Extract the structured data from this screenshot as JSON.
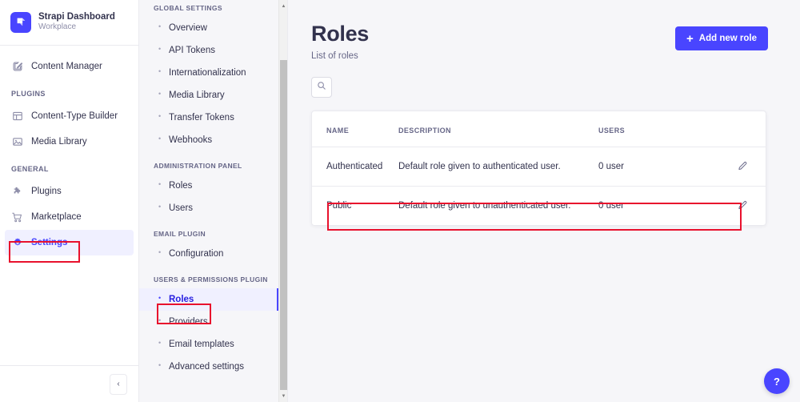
{
  "brand": {
    "title": "Strapi Dashboard",
    "subtitle": "Workplace",
    "logo_color": "#4945ff",
    "logo_icon": "strapi-logo-icon"
  },
  "sidebar": {
    "primary_items": [
      {
        "label": "Content Manager",
        "icon": "pencil-square-icon",
        "active": false
      }
    ],
    "sections": [
      {
        "label": "PLUGINS",
        "items": [
          {
            "label": "Content-Type Builder",
            "icon": "layout-icon",
            "active": false
          },
          {
            "label": "Media Library",
            "icon": "image-icon",
            "active": false
          }
        ]
      },
      {
        "label": "GENERAL",
        "items": [
          {
            "label": "Plugins",
            "icon": "puzzle-icon",
            "active": false
          },
          {
            "label": "Marketplace",
            "icon": "shopping-cart-icon",
            "active": false
          },
          {
            "label": "Settings",
            "icon": "gear-icon",
            "active": true
          }
        ]
      }
    ],
    "collapse_label": "‹"
  },
  "subnav": {
    "sections": [
      {
        "label": "GLOBAL SETTINGS",
        "items": [
          {
            "label": "Overview",
            "active": false
          },
          {
            "label": "API Tokens",
            "active": false
          },
          {
            "label": "Internationalization",
            "active": false
          },
          {
            "label": "Media Library",
            "active": false
          },
          {
            "label": "Transfer Tokens",
            "active": false
          },
          {
            "label": "Webhooks",
            "active": false
          }
        ]
      },
      {
        "label": "ADMINISTRATION PANEL",
        "items": [
          {
            "label": "Roles",
            "active": false
          },
          {
            "label": "Users",
            "active": false
          }
        ]
      },
      {
        "label": "EMAIL PLUGIN",
        "items": [
          {
            "label": "Configuration",
            "active": false
          }
        ]
      },
      {
        "label": "USERS & PERMISSIONS PLUGIN",
        "items": [
          {
            "label": "Roles",
            "active": true
          },
          {
            "label": "Providers",
            "active": false
          },
          {
            "label": "Email templates",
            "active": false
          },
          {
            "label": "Advanced settings",
            "active": false
          }
        ]
      }
    ]
  },
  "main": {
    "title": "Roles",
    "subtitle": "List of roles",
    "add_button_label": "Add new role",
    "add_button_icon": "plus-icon",
    "search_icon": "search-icon",
    "table": {
      "headers": [
        "NAME",
        "DESCRIPTION",
        "USERS",
        ""
      ],
      "rows": [
        {
          "name": "Authenticated",
          "description": "Default role given to authenticated user.",
          "users": "0 user",
          "action_icon": "pencil-icon",
          "highlighted": false
        },
        {
          "name": "Public",
          "description": "Default role given to unauthenticated user.",
          "users": "0 user",
          "action_icon": "pencil-icon",
          "highlighted": true
        }
      ]
    }
  },
  "help": {
    "label": "?",
    "icon": "question-mark-icon"
  },
  "colors": {
    "accent": "#4945ff",
    "accent_text": "#271fe0",
    "accent_bg": "#f0f0ff",
    "annotation": "#e8112d",
    "page_bg": "#f6f6f9",
    "text_primary": "#32324d",
    "text_muted": "#666687",
    "border": "#eaeaef"
  }
}
